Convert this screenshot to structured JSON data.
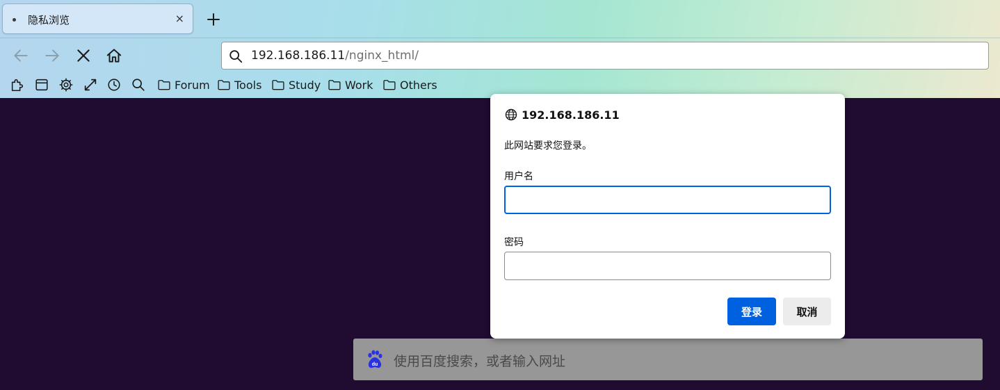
{
  "tab": {
    "title": "隐私浏览",
    "close_glyph": "×"
  },
  "nav": {
    "back_icon": "arrow-left-icon",
    "forward_icon": "arrow-right-icon",
    "stop_icon": "close-icon",
    "home_icon": "home-icon"
  },
  "urlbar": {
    "host": "192.168.186.11",
    "path": "/nginx_html/"
  },
  "bookmarks": {
    "icons": [
      "extensions-icon",
      "sidebar-icon",
      "gear-icon",
      "fullscreen-icon",
      "history-icon",
      "search-icon"
    ],
    "folders": [
      {
        "label": "Forum"
      },
      {
        "label": "Tools"
      },
      {
        "label": "Study"
      },
      {
        "label": "Work"
      },
      {
        "label": "Others"
      }
    ]
  },
  "content": {
    "background": "#200b31",
    "search_placeholder": "使用百度搜索，或者输入网址"
  },
  "dialog": {
    "host": "192.168.186.11",
    "message": "此网站要求您登录。",
    "username_label": "用户名",
    "username_value": "",
    "password_label": "密码",
    "password_value": "",
    "login_label": "登录",
    "cancel_label": "取消",
    "accent": "#0061e0"
  }
}
